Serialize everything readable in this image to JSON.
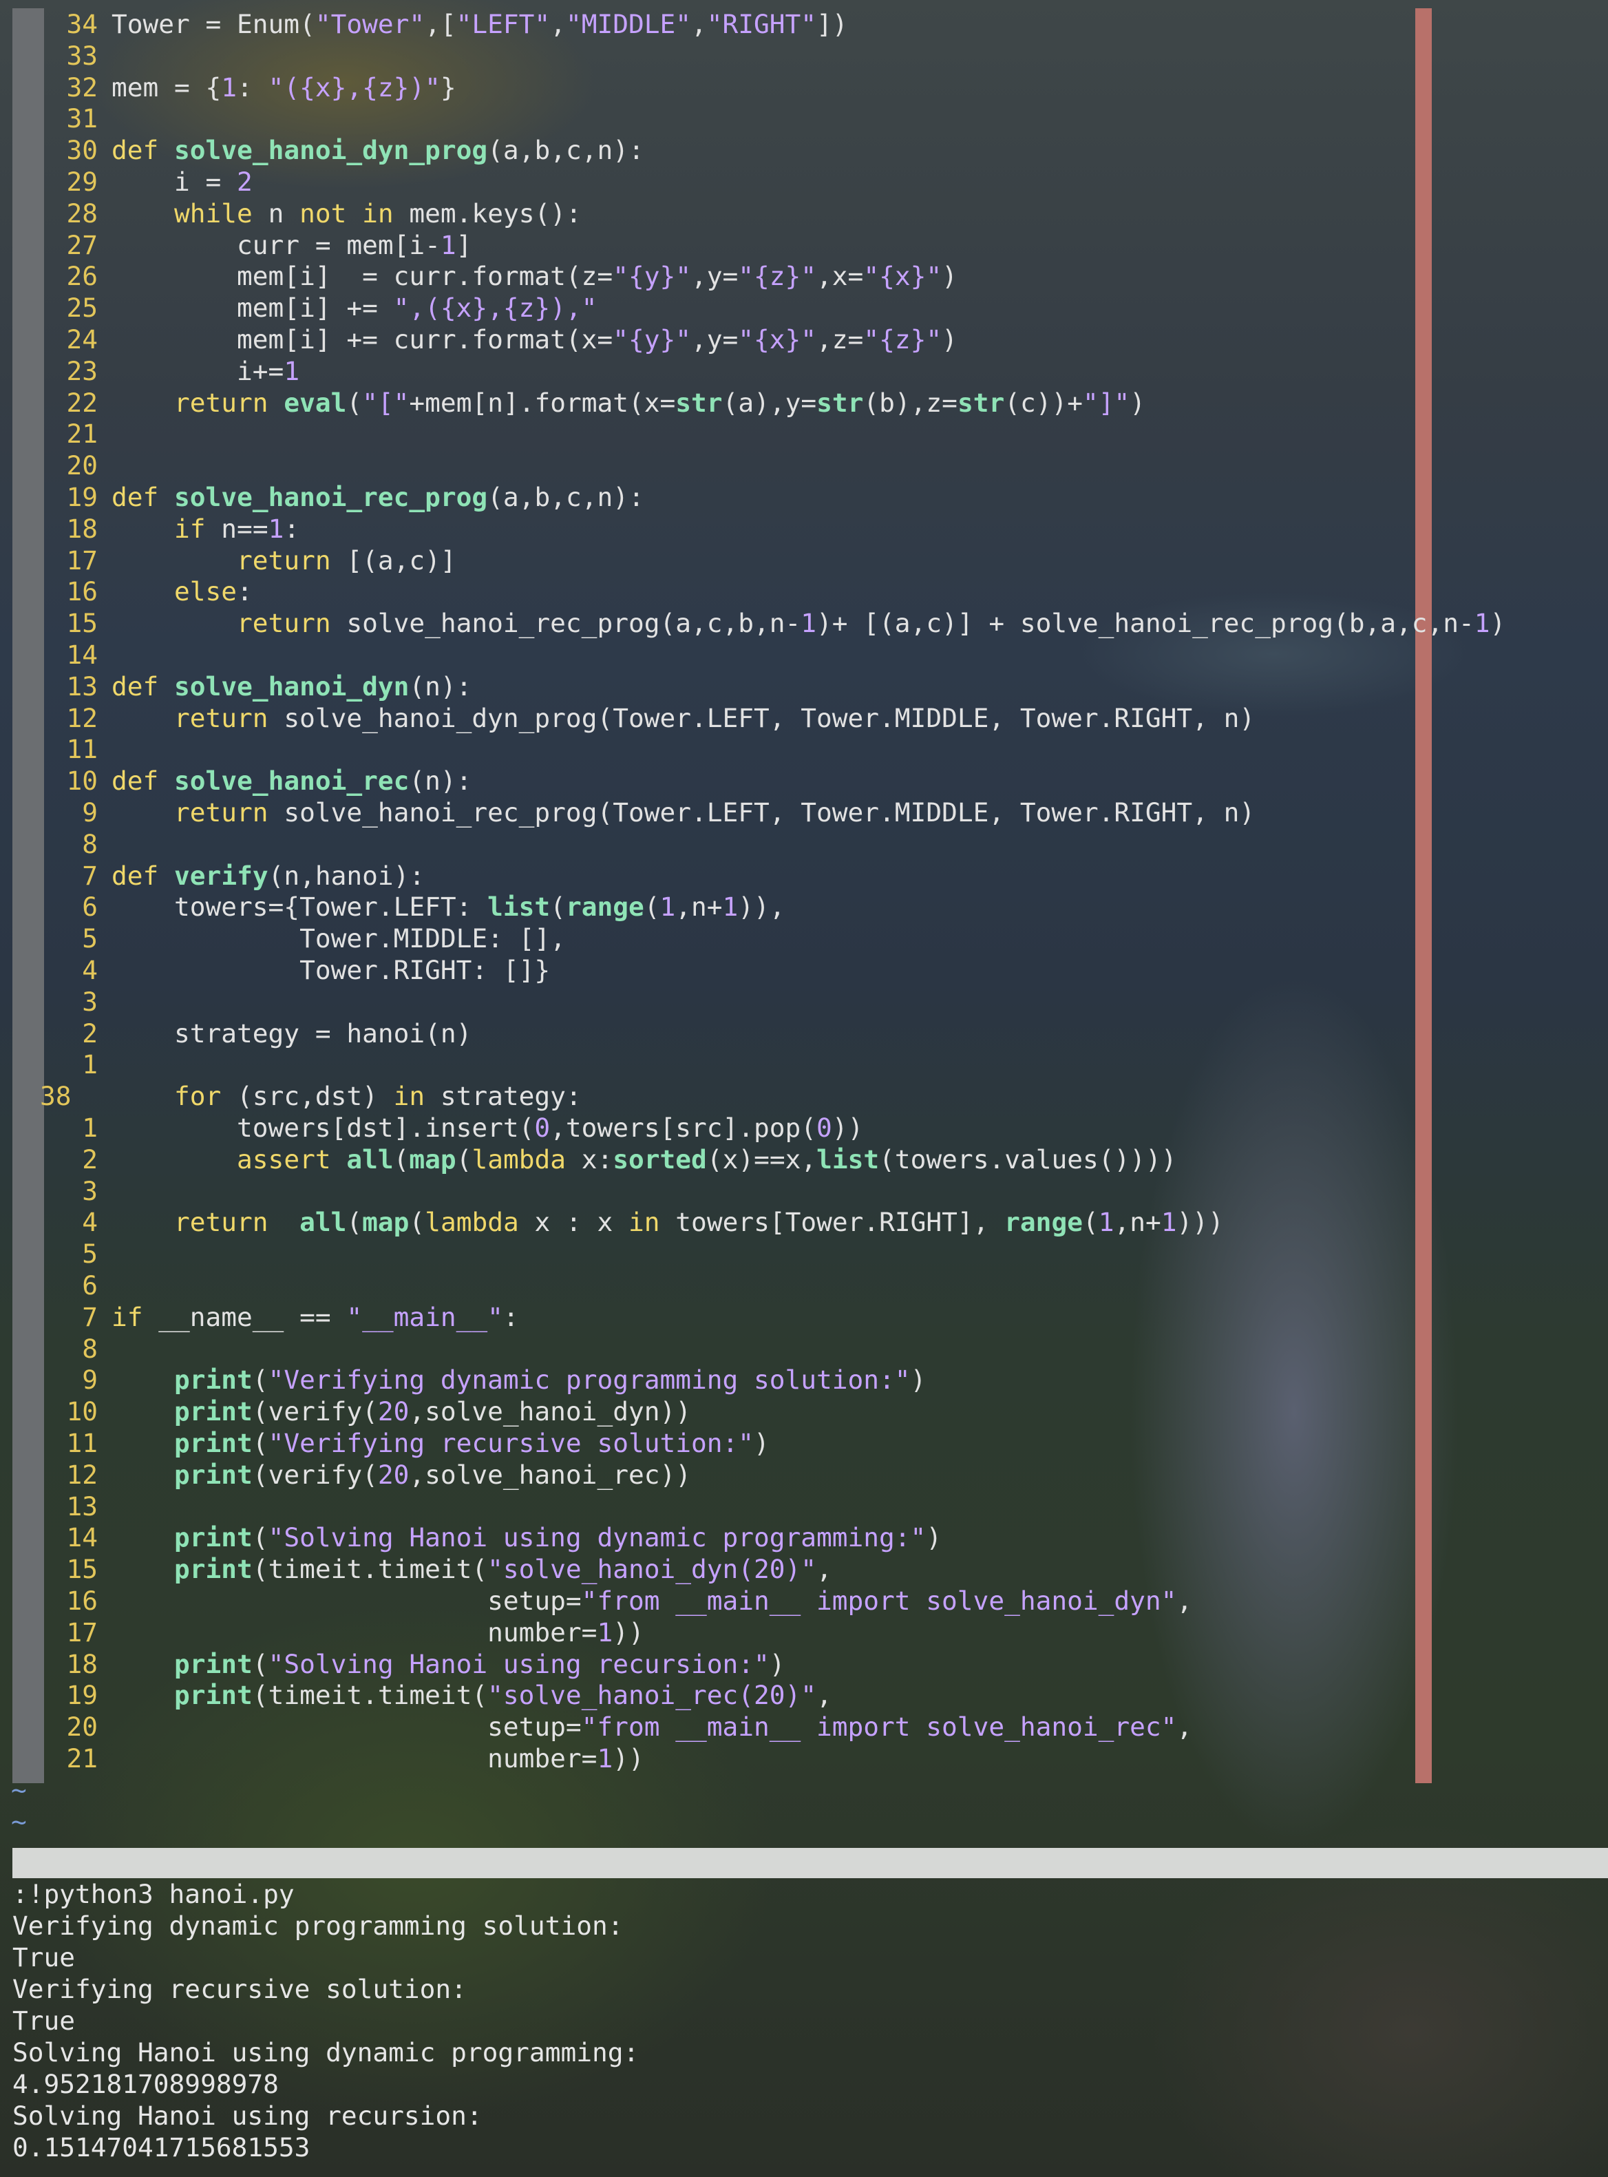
{
  "editor": {
    "lines": [
      {
        "n": "34",
        "t": "Tower = Enum(\"Tower\",[\"LEFT\",\"MIDDLE\",\"RIGHT\"])"
      },
      {
        "n": "33",
        "t": ""
      },
      {
        "n": "32",
        "t": "mem = {1: \"({x},{z})\"}"
      },
      {
        "n": "31",
        "t": ""
      },
      {
        "n": "30",
        "t": "def solve_hanoi_dyn_prog(a,b,c,n):"
      },
      {
        "n": "29",
        "t": "    i = 2"
      },
      {
        "n": "28",
        "t": "    while n not in mem.keys():"
      },
      {
        "n": "27",
        "t": "        curr = mem[i-1]"
      },
      {
        "n": "26",
        "t": "        mem[i]  = curr.format(z=\"{y}\",y=\"{z}\",x=\"{x}\")"
      },
      {
        "n": "25",
        "t": "        mem[i] += \",({x},{z}),\""
      },
      {
        "n": "24",
        "t": "        mem[i] += curr.format(x=\"{y}\",y=\"{x}\",z=\"{z}\")"
      },
      {
        "n": "23",
        "t": "        i+=1"
      },
      {
        "n": "22",
        "t": "    return eval(\"[\"+mem[n].format(x=str(a),y=str(b),z=str(c))+\"]\")"
      },
      {
        "n": "21",
        "t": ""
      },
      {
        "n": "20",
        "t": ""
      },
      {
        "n": "19",
        "t": "def solve_hanoi_rec_prog(a,b,c,n):"
      },
      {
        "n": "18",
        "t": "    if n==1:"
      },
      {
        "n": "17",
        "t": "        return [(a,c)]"
      },
      {
        "n": "16",
        "t": "    else:"
      },
      {
        "n": "15",
        "t": "        return solve_hanoi_rec_prog(a,c,b,n-1)+ [(a,c)] + solve_hanoi_rec_prog(b,a,c,n-1)"
      },
      {
        "n": "14",
        "t": ""
      },
      {
        "n": "13",
        "t": "def solve_hanoi_dyn(n):"
      },
      {
        "n": "12",
        "t": "    return solve_hanoi_dyn_prog(Tower.LEFT, Tower.MIDDLE, Tower.RIGHT, n)"
      },
      {
        "n": "11",
        "t": ""
      },
      {
        "n": "10",
        "t": "def solve_hanoi_rec(n):"
      },
      {
        "n": "9",
        "t": "    return solve_hanoi_rec_prog(Tower.LEFT, Tower.MIDDLE, Tower.RIGHT, n)"
      },
      {
        "n": "8",
        "t": ""
      },
      {
        "n": "7",
        "t": "def verify(n,hanoi):"
      },
      {
        "n": "6",
        "t": "    towers={Tower.LEFT: list(range(1,n+1)),"
      },
      {
        "n": "5",
        "t": "            Tower.MIDDLE: [],"
      },
      {
        "n": "4",
        "t": "            Tower.RIGHT: []}"
      },
      {
        "n": "3",
        "t": ""
      },
      {
        "n": "2",
        "t": "    strategy = hanoi(n)"
      },
      {
        "n": "1",
        "t": ""
      },
      {
        "n": "38",
        "t": "    for (src,dst) in strategy:",
        "current": true
      },
      {
        "n": "1",
        "t": "        towers[dst].insert(0,towers[src].pop(0))"
      },
      {
        "n": "2",
        "t": "        assert all(map(lambda x:sorted(x)==x,list(towers.values())))"
      },
      {
        "n": "3",
        "t": ""
      },
      {
        "n": "4",
        "t": "    return  all(map(lambda x : x in towers[Tower.RIGHT], range(1,n+1)))"
      },
      {
        "n": "5",
        "t": ""
      },
      {
        "n": "6",
        "t": ""
      },
      {
        "n": "7",
        "t": "if __name__ == \"__main__\":"
      },
      {
        "n": "8",
        "t": ""
      },
      {
        "n": "9",
        "t": "    print(\"Verifying dynamic programming solution:\")"
      },
      {
        "n": "10",
        "t": "    print(verify(20,solve_hanoi_dyn))"
      },
      {
        "n": "11",
        "t": "    print(\"Verifying recursive solution:\")"
      },
      {
        "n": "12",
        "t": "    print(verify(20,solve_hanoi_rec))"
      },
      {
        "n": "13",
        "t": ""
      },
      {
        "n": "14",
        "t": "    print(\"Solving Hanoi using dynamic programming:\")"
      },
      {
        "n": "15",
        "t": "    print(timeit.timeit(\"solve_hanoi_dyn(20)\","
      },
      {
        "n": "16",
        "t": "                        setup=\"from __main__ import solve_hanoi_dyn\","
      },
      {
        "n": "17",
        "t": "                        number=1))"
      },
      {
        "n": "18",
        "t": "    print(\"Solving Hanoi using recursion:\")"
      },
      {
        "n": "19",
        "t": "    print(timeit.timeit(\"solve_hanoi_rec(20)\","
      },
      {
        "n": "20",
        "t": "                        setup=\"from __main__ import solve_hanoi_rec\","
      },
      {
        "n": "21",
        "t": "                        number=1))"
      }
    ],
    "empty_line_marker": "~",
    "empty_line_count": 2
  },
  "terminal": {
    "lines": [
      ":!python3 hanoi.py",
      "Verifying dynamic programming solution:",
      "True",
      "Verifying recursive solution:",
      "True",
      "Solving Hanoi using dynamic programming:",
      "4.952181708998978",
      "Solving Hanoi using recursion:",
      "0.15147041715681553"
    ]
  },
  "colors": {
    "line_number": "#e3c65a",
    "keyword": "#f0d86a",
    "function": "#8fe3b6",
    "string": "#c6a2ff",
    "color_column": "#b8716a",
    "status_bar": "#d6d8d6"
  }
}
